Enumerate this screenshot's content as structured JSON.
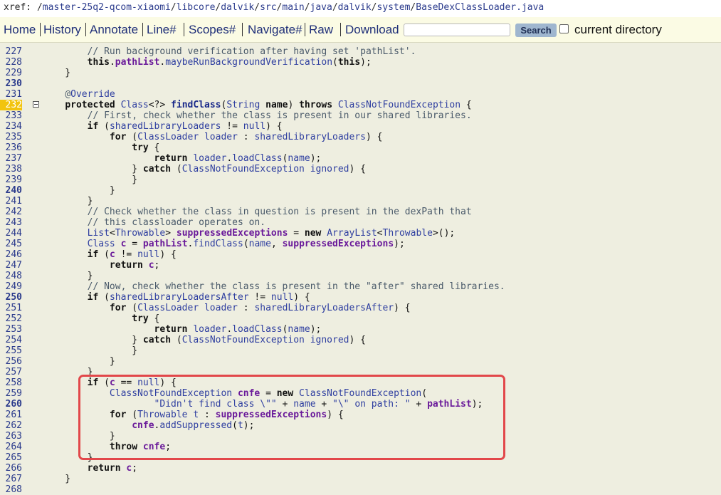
{
  "breadcrumb": {
    "prefix": "xref:",
    "segments": [
      "master-25q2-qcom-xiaomi",
      "libcore",
      "dalvik",
      "src",
      "main",
      "java",
      "dalvik",
      "system",
      "BaseDexClassLoader.java"
    ]
  },
  "menu": {
    "items": [
      "Home",
      "History",
      "Annotate",
      "Line#",
      "Scopes#",
      "Navigate#",
      "Raw",
      "Download"
    ],
    "search_placeholder": "",
    "search_button": "Search",
    "current_directory_label": "current directory"
  },
  "code": {
    "highlighted_line": "232",
    "lines": [
      {
        "n": "227",
        "b": false,
        "h": "        <span class='c'>// Run background verification after having set 'pathList'.</span>"
      },
      {
        "n": "228",
        "b": false,
        "h": "        <span class='k'>this</span>.<span class='f'>pathList</span>.<span class='m'>maybeRunBackgroundVerification</span>(<span class='k'>this</span>);"
      },
      {
        "n": "229",
        "b": false,
        "h": "    }"
      },
      {
        "n": "230",
        "b": true,
        "h": ""
      },
      {
        "n": "231",
        "b": false,
        "h": "    <span class='c'>@</span><span class='t'>Override</span>"
      },
      {
        "n": "232",
        "b": false,
        "h": "    <span class='k'>protected</span> <span class='t'>Class</span>&lt;?&gt; <span class='fn'>findClass</span>(<span class='t'>String</span> <span class='k'>name</span>) <span class='k'>throws</span> <span class='t'>ClassNotFoundException</span> {"
      },
      {
        "n": "233",
        "b": false,
        "h": "        <span class='c'>// First, check whether the class is present in our shared libraries.</span>"
      },
      {
        "n": "234",
        "b": false,
        "h": "        <span class='k'>if</span> (<span class='m'>sharedLibraryLoaders</span> != <span class='n'>null</span>) {"
      },
      {
        "n": "235",
        "b": false,
        "h": "            <span class='k'>for</span> (<span class='t'>ClassLoader</span> <span class='m'>loader</span> : <span class='m'>sharedLibraryLoaders</span>) {"
      },
      {
        "n": "236",
        "b": false,
        "h": "                <span class='k'>try</span> {"
      },
      {
        "n": "237",
        "b": false,
        "h": "                    <span class='k'>return</span> <span class='m'>loader</span>.<span class='m'>loadClass</span>(<span class='m'>name</span>);"
      },
      {
        "n": "238",
        "b": false,
        "h": "                } <span class='k'>catch</span> (<span class='t'>ClassNotFoundException</span> <span class='m'>ignored</span>) {"
      },
      {
        "n": "239",
        "b": false,
        "h": "                }"
      },
      {
        "n": "240",
        "b": true,
        "h": "            }"
      },
      {
        "n": "241",
        "b": false,
        "h": "        }"
      },
      {
        "n": "242",
        "b": false,
        "h": "        <span class='c'>// Check whether the class in question is present in the dexPath that</span>"
      },
      {
        "n": "243",
        "b": false,
        "h": "        <span class='c'>// this classloader operates on.</span>"
      },
      {
        "n": "244",
        "b": false,
        "h": "        <span class='t'>List</span>&lt;<span class='t'>Throwable</span>&gt; <span class='f'>suppressedExceptions</span> = <span class='k'>new</span> <span class='t'>ArrayList</span>&lt;<span class='t'>Throwable</span>&gt;();"
      },
      {
        "n": "245",
        "b": false,
        "h": "        <span class='t'>Class</span> <span class='f'>c</span> = <span class='f'>pathList</span>.<span class='m'>findClass</span>(<span class='m'>name</span>, <span class='f'>suppressedExceptions</span>);"
      },
      {
        "n": "246",
        "b": false,
        "h": "        <span class='k'>if</span> (<span class='f'>c</span> != <span class='n'>null</span>) {"
      },
      {
        "n": "247",
        "b": false,
        "h": "            <span class='k'>return</span> <span class='f'>c</span>;"
      },
      {
        "n": "248",
        "b": false,
        "h": "        }"
      },
      {
        "n": "249",
        "b": false,
        "h": "        <span class='c'>// Now, check whether the class is present in the \"after\" shared libraries.</span>"
      },
      {
        "n": "250",
        "b": true,
        "h": "        <span class='k'>if</span> (<span class='m'>sharedLibraryLoadersAfter</span> != <span class='n'>null</span>) {"
      },
      {
        "n": "251",
        "b": false,
        "h": "            <span class='k'>for</span> (<span class='t'>ClassLoader</span> <span class='m'>loader</span> : <span class='m'>sharedLibraryLoadersAfter</span>) {"
      },
      {
        "n": "252",
        "b": false,
        "h": "                <span class='k'>try</span> {"
      },
      {
        "n": "253",
        "b": false,
        "h": "                    <span class='k'>return</span> <span class='m'>loader</span>.<span class='m'>loadClass</span>(<span class='m'>name</span>);"
      },
      {
        "n": "254",
        "b": false,
        "h": "                } <span class='k'>catch</span> (<span class='t'>ClassNotFoundException</span> <span class='m'>ignored</span>) {"
      },
      {
        "n": "255",
        "b": false,
        "h": "                }"
      },
      {
        "n": "256",
        "b": false,
        "h": "            }"
      },
      {
        "n": "257",
        "b": false,
        "h": "        }"
      },
      {
        "n": "258",
        "b": false,
        "h": "        <span class='k'>if</span> (<span class='f'>c</span> == <span class='n'>null</span>) {"
      },
      {
        "n": "259",
        "b": false,
        "h": "            <span class='t'>ClassNotFoundException</span> <span class='f'>cnfe</span> = <span class='k'>new</span> <span class='t'>ClassNotFoundException</span>("
      },
      {
        "n": "260",
        "b": true,
        "h": "                    <span class='s'>\"Didn't find class \\\"\"</span> + <span class='m'>name</span> + <span class='s'>\"\\\" on path: \"</span> + <span class='f'>pathList</span>);"
      },
      {
        "n": "261",
        "b": false,
        "h": "            <span class='k'>for</span> (<span class='t'>Throwable</span> <span class='m'>t</span> : <span class='f'>suppressedExceptions</span>) {"
      },
      {
        "n": "262",
        "b": false,
        "h": "                <span class='f'>cnfe</span>.<span class='m'>addSuppressed</span>(<span class='m'>t</span>);"
      },
      {
        "n": "263",
        "b": false,
        "h": "            }"
      },
      {
        "n": "264",
        "b": false,
        "h": "            <span class='k'>throw</span> <span class='f'>cnfe</span>;"
      },
      {
        "n": "265",
        "b": false,
        "h": "        }"
      },
      {
        "n": "266",
        "b": false,
        "h": "        <span class='k'>return</span> <span class='f'>c</span>;"
      },
      {
        "n": "267",
        "b": false,
        "h": "    }"
      },
      {
        "n": "268",
        "b": false,
        "h": ""
      }
    ]
  }
}
